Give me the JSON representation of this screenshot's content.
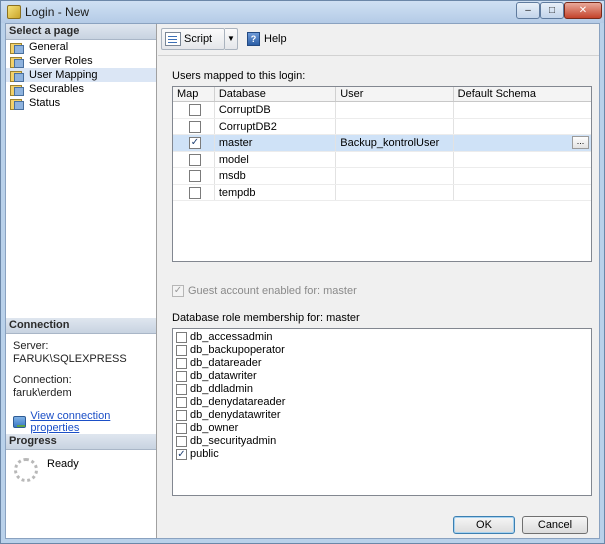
{
  "window": {
    "title": "Login - New",
    "controls": {
      "minimize": "–",
      "maximize": "□",
      "close": "✕"
    }
  },
  "nav": {
    "header": "Select a page",
    "items": [
      {
        "label": "General",
        "icon": "page-icon"
      },
      {
        "label": "Server Roles",
        "icon": "page-icon"
      },
      {
        "label": "User Mapping",
        "icon": "page-icon",
        "selected": true
      },
      {
        "label": "Securables",
        "icon": "page-icon"
      },
      {
        "label": "Status",
        "icon": "page-icon"
      }
    ]
  },
  "connection": {
    "header": "Connection",
    "server_label": "Server:",
    "server_value": "FARUK\\SQLEXPRESS",
    "connection_label": "Connection:",
    "connection_value": "faruk\\erdem",
    "link": "View connection properties"
  },
  "progress": {
    "header": "Progress",
    "status": "Ready"
  },
  "toolbar": {
    "script_label": "Script",
    "dropdown": "▼",
    "help_label": "Help"
  },
  "users_grid": {
    "caption": "Users mapped to this login:",
    "columns": [
      "Map",
      "Database",
      "User",
      "Default Schema"
    ],
    "rows": [
      {
        "map": false,
        "database": "CorruptDB",
        "user": "",
        "schema": ""
      },
      {
        "map": false,
        "database": "CorruptDB2",
        "user": "",
        "schema": ""
      },
      {
        "map": true,
        "database": "master",
        "user": "Backup_kontrolUser",
        "schema": "",
        "selected": true
      },
      {
        "map": false,
        "database": "model",
        "user": "",
        "schema": ""
      },
      {
        "map": false,
        "database": "msdb",
        "user": "",
        "schema": ""
      },
      {
        "map": false,
        "database": "tempdb",
        "user": "",
        "schema": ""
      }
    ],
    "ellipsis": "..."
  },
  "guest": {
    "label": "Guest account enabled for: master",
    "checked": true,
    "check_mark": "✓"
  },
  "roles": {
    "caption": "Database role membership for: master",
    "items": [
      {
        "label": "db_accessadmin",
        "checked": false
      },
      {
        "label": "db_backupoperator",
        "checked": false
      },
      {
        "label": "db_datareader",
        "checked": false
      },
      {
        "label": "db_datawriter",
        "checked": false
      },
      {
        "label": "db_ddladmin",
        "checked": false
      },
      {
        "label": "db_denydatareader",
        "checked": false
      },
      {
        "label": "db_denydatawriter",
        "checked": false
      },
      {
        "label": "db_owner",
        "checked": false
      },
      {
        "label": "db_securityadmin",
        "checked": false
      },
      {
        "label": "public",
        "checked": true
      }
    ]
  },
  "buttons": {
    "ok": "OK",
    "cancel": "Cancel"
  }
}
